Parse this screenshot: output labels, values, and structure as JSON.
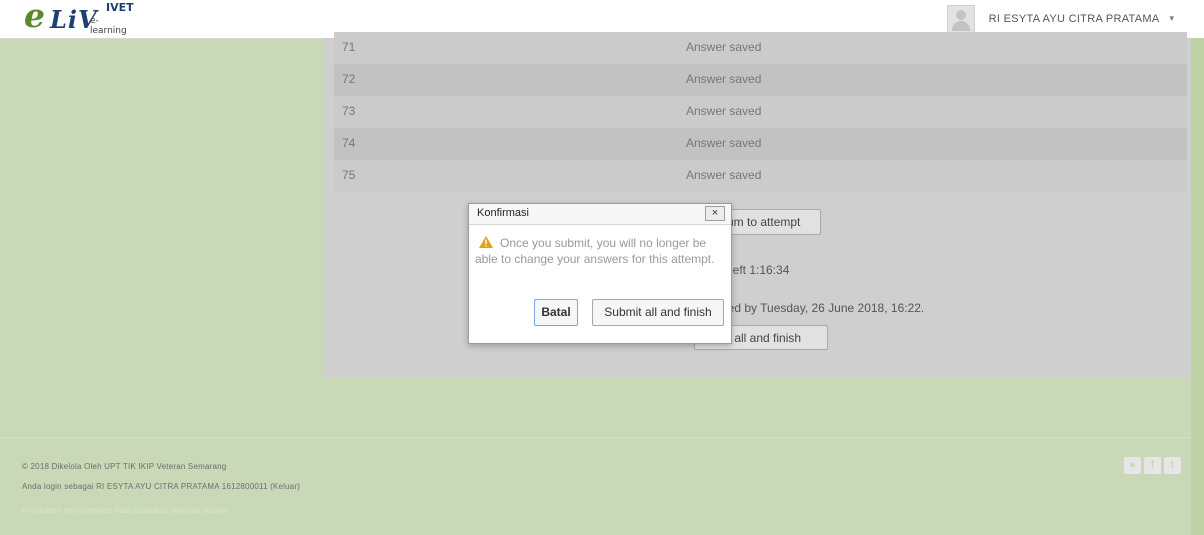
{
  "header": {
    "logo_e": "e",
    "logo_liv": "LiV",
    "logo_ivet": "IVET",
    "logo_elearning": "e-learning",
    "user_name": "RI ESYTA AYU CITRA PRATAMA",
    "caret": "▾"
  },
  "summary_rows": [
    {
      "num": "71",
      "status": "Answer saved"
    },
    {
      "num": "72",
      "status": "Answer saved"
    },
    {
      "num": "73",
      "status": "Answer saved"
    },
    {
      "num": "74",
      "status": "Answer saved"
    },
    {
      "num": "75",
      "status": "Answer saved"
    }
  ],
  "background": {
    "return_button": "um to attempt",
    "time_left": "e left 1:16:34",
    "submitted_by": "tted by Tuesday, 26 June 2018, 16:22.",
    "submit_button": "it all and finish"
  },
  "modal": {
    "title": "Konfirmasi",
    "close": "×",
    "message": "Once you submit, you will no longer be able to change your answers for this attempt.",
    "cancel_label": "Batal",
    "submit_label": "Submit all and finish"
  },
  "footer": {
    "line1": "© 2018 Dikelola Oleh UPT TIK IKIP Veteran Semarang",
    "line2": "Anda login sebagai RI ESYTA AYU CITRA PRATAMA 1612800011 (Keluar)",
    "line3": "Ringkasan pengambilan data   Dapatkan aplikasi seluler",
    "social_icons": [
      "globe-icon",
      "facebook-icon",
      "twitter-icon"
    ],
    "social_glyphs": [
      "●",
      "f",
      "t"
    ]
  },
  "colors": {
    "page_bg": "#c9d9b8",
    "panel_bg": "#cfcfcf",
    "warning": "#e0a21b"
  }
}
